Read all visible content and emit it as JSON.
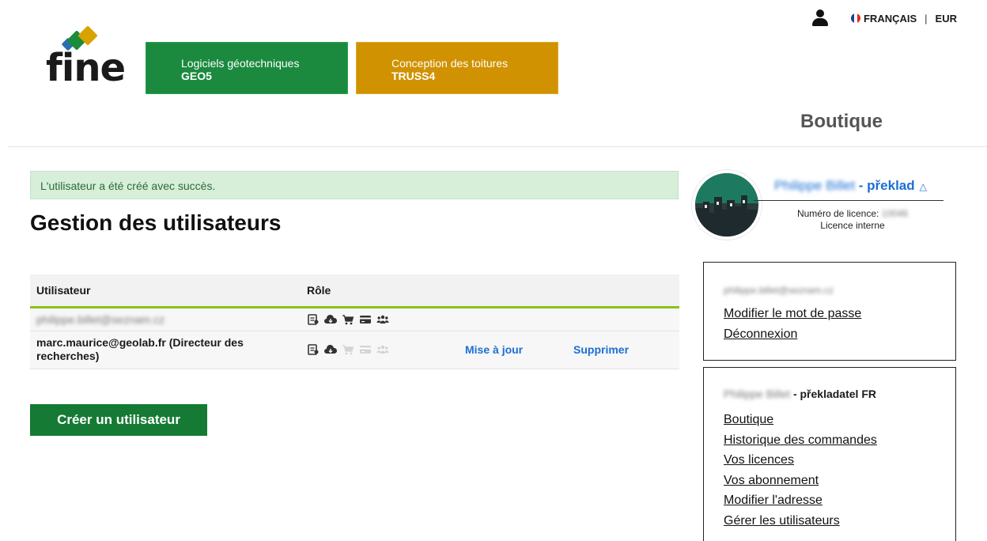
{
  "topbar": {
    "language": "FRANÇAIS",
    "separator": "|",
    "currency": "EUR"
  },
  "logo": {
    "text": "fine"
  },
  "products": [
    {
      "title": "Logiciels géotechniques",
      "name": "GEO5",
      "color": "#1b8a3e"
    },
    {
      "title": "Conception des toitures",
      "name": "TRUSS4",
      "color": "#d09200"
    }
  ],
  "section_title": "Boutique",
  "alert": {
    "message": "L'utilisateur a été créé avec succès."
  },
  "page_title": "Gestion des utilisateurs",
  "table": {
    "headers": {
      "user": "Utilisateur",
      "role": "Rôle"
    },
    "rows": [
      {
        "user": "philippe.billet@seznam.cz",
        "blurred": true,
        "roles_active": [
          true,
          true,
          true,
          true,
          true
        ]
      },
      {
        "user": "marc.maurice@geolab.fr (Directeur des recherches)",
        "blurred": false,
        "roles_active": [
          true,
          true,
          false,
          false,
          false
        ],
        "update_label": "Mise à jour",
        "delete_label": "Supprimer"
      }
    ],
    "role_icons": [
      "license-icon",
      "cloud-download-icon",
      "cart-icon",
      "credit-card-icon",
      "users-icon"
    ]
  },
  "create_button": "Créer un utilisateur",
  "profile": {
    "name": "Philippe Billet",
    "name_suffix": " - překlad",
    "license_label": "Numéro de licence:",
    "license_number": "10046",
    "license_type": "Licence interne"
  },
  "account_box": {
    "email": "philippe.billet@seznam.cz",
    "links": [
      "Modifier le mot de passe",
      "Déconnexion"
    ]
  },
  "nav_box": {
    "owner_name": "Philippe Billet",
    "owner_suffix": " - překladatel FR",
    "links": [
      "Boutique",
      "Historique des commandes",
      "Vos licences",
      "Vos abonnement",
      "Modifier l'adresse",
      "Gérer les utilisateurs"
    ]
  },
  "colors": {
    "geo5": "#1b8a3e",
    "truss": "#d09200",
    "link_blue": "#1c6fd4",
    "table_accent": "#8dc11c",
    "alert_bg": "#d7eed9"
  }
}
